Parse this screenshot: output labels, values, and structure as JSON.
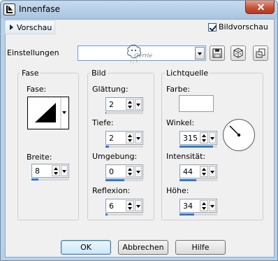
{
  "window": {
    "title": "Innenfase",
    "icon": "bevel-app-icon"
  },
  "header": {
    "preview_label": "Vorschau",
    "bildvorschau_label": "Bildvorschau",
    "bildvorschau_checked": true
  },
  "settings": {
    "label": "Einstellungen",
    "preset_value": "",
    "watermark_text": "Gerrie",
    "icons": [
      "save-preset-icon",
      "random-dice-icon",
      "reset-preset-icon"
    ]
  },
  "fase": {
    "group_title": "Fase",
    "fase_label": "Fase:",
    "breite_label": "Breite:",
    "breite_value": "8",
    "breite_level": 0.18
  },
  "bild": {
    "group_title": "Bild",
    "glaettung_label": "Glättung:",
    "glaettung_value": "2",
    "glaettung_level": 0.02,
    "tiefe_label": "Tiefe:",
    "tiefe_value": "2",
    "tiefe_level": 0.1,
    "umgebung_label": "Umgebung:",
    "umgebung_value": "0",
    "umgebung_level": 0.5,
    "reflexion_label": "Reflexion:",
    "reflexion_value": "6",
    "reflexion_level": 0.06
  },
  "licht": {
    "group_title": "Lichtquelle",
    "farbe_label": "Farbe:",
    "farbe_value": "#ffffff",
    "winkel_label": "Winkel:",
    "winkel_value": "315",
    "winkel_level": 0.88,
    "intensitaet_label": "Intensität:",
    "intensitaet_value": "44",
    "intensitaet_level": 0.44,
    "hoehe_label": "Höhe:",
    "hoehe_value": "34",
    "hoehe_level": 0.38
  },
  "buttons": {
    "ok": "OK",
    "abbrechen": "Abbrechen",
    "hilfe": "Hilfe"
  },
  "colors": {
    "accent": "#2d79d3",
    "titlebar": "#b8d0e8",
    "close": "#c74d35"
  }
}
